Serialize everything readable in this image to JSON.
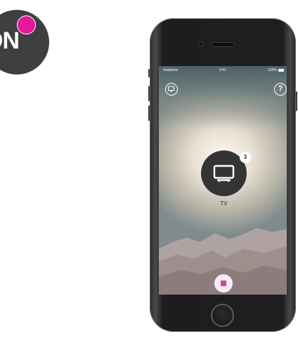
{
  "logo": {
    "text": "ON",
    "color": "#3f3f41",
    "dot_color": "#e6189a"
  },
  "phone": {
    "status_bar": {
      "carrier": "Vodafone",
      "time": "9:41",
      "battery": "100%"
    },
    "top_left_icon": "cast-icon",
    "top_right_icon": "help-icon",
    "help_symbol": "?",
    "device": {
      "label": "TV",
      "badge_count": "3",
      "icon": "tv-icon"
    },
    "bottom_button_icon": "stop-icon",
    "accent_color": "#e23c9a"
  }
}
